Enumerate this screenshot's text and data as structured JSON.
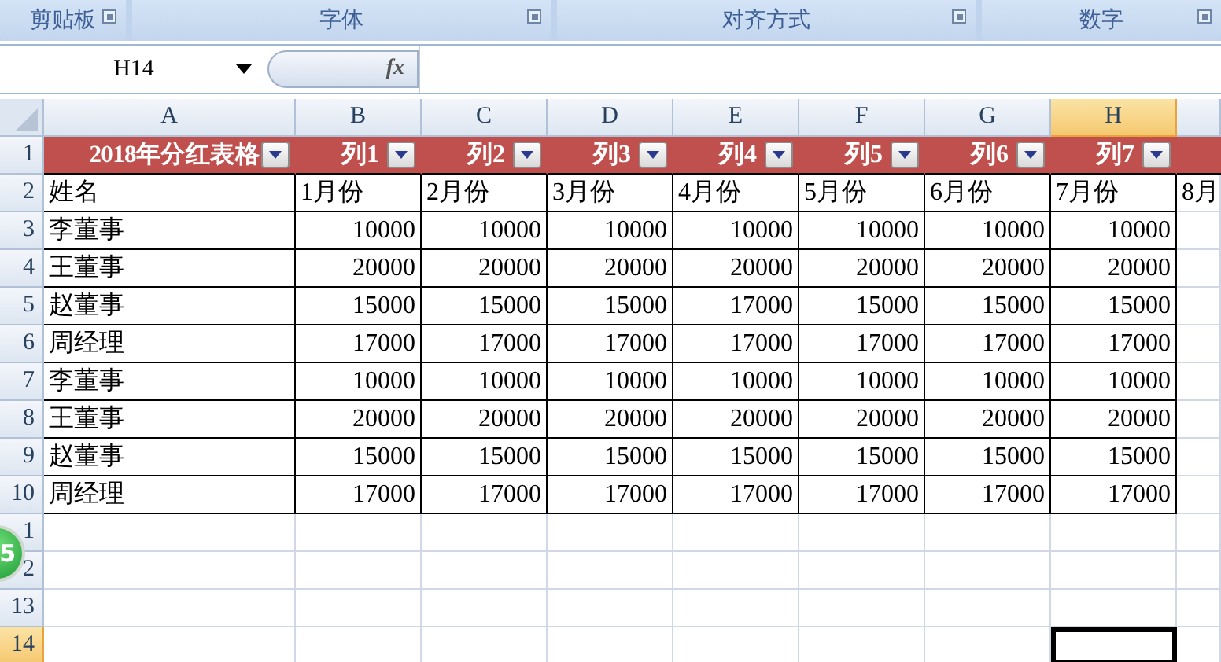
{
  "ribbon_groups": [
    {
      "label": "剪贴板"
    },
    {
      "label": "字体"
    },
    {
      "label": "对齐方式"
    },
    {
      "label": "数字"
    }
  ],
  "name_box": {
    "value": "H14"
  },
  "formula_bar": {
    "fx_label": "fx"
  },
  "columns": [
    {
      "letter": "A",
      "selected": false
    },
    {
      "letter": "B",
      "selected": false
    },
    {
      "letter": "C",
      "selected": false
    },
    {
      "letter": "D",
      "selected": false
    },
    {
      "letter": "E",
      "selected": false
    },
    {
      "letter": "F",
      "selected": false
    },
    {
      "letter": "G",
      "selected": false
    },
    {
      "letter": "H",
      "selected": true
    }
  ],
  "rows": [
    {
      "number": "1",
      "kind": "header",
      "selected": false,
      "cells": [
        "2018年分红表格",
        "列1",
        "列2",
        "列3",
        "列4",
        "列5",
        "列6",
        "列7"
      ]
    },
    {
      "number": "2",
      "kind": "labels",
      "selected": false,
      "cells": [
        "姓名",
        "1月份",
        "2月份",
        "3月份",
        "4月份",
        "5月份",
        "6月份",
        "7月份",
        "8月"
      ]
    },
    {
      "number": "3",
      "kind": "data",
      "selected": false,
      "cells": [
        "李董事",
        "10000",
        "10000",
        "10000",
        "10000",
        "10000",
        "10000",
        "10000"
      ]
    },
    {
      "number": "4",
      "kind": "data",
      "selected": false,
      "cells": [
        "王董事",
        "20000",
        "20000",
        "20000",
        "20000",
        "20000",
        "20000",
        "20000"
      ]
    },
    {
      "number": "5",
      "kind": "data",
      "selected": false,
      "cells": [
        "赵董事",
        "15000",
        "15000",
        "15000",
        "17000",
        "15000",
        "15000",
        "15000"
      ]
    },
    {
      "number": "6",
      "kind": "data",
      "selected": false,
      "cells": [
        "周经理",
        "17000",
        "17000",
        "17000",
        "17000",
        "17000",
        "17000",
        "17000"
      ]
    },
    {
      "number": "7",
      "kind": "data",
      "selected": false,
      "cells": [
        "李董事",
        "10000",
        "10000",
        "10000",
        "10000",
        "10000",
        "10000",
        "10000"
      ]
    },
    {
      "number": "8",
      "kind": "data",
      "selected": false,
      "cells": [
        "王董事",
        "20000",
        "20000",
        "20000",
        "20000",
        "20000",
        "20000",
        "20000"
      ]
    },
    {
      "number": "9",
      "kind": "data",
      "selected": false,
      "cells": [
        "赵董事",
        "15000",
        "15000",
        "15000",
        "15000",
        "15000",
        "15000",
        "15000"
      ]
    },
    {
      "number": "10",
      "kind": "data",
      "selected": false,
      "cells": [
        "周经理",
        "17000",
        "17000",
        "17000",
        "17000",
        "17000",
        "17000",
        "17000"
      ]
    },
    {
      "number": "1",
      "kind": "empty",
      "selected": false,
      "cells": []
    },
    {
      "number": "2",
      "kind": "empty",
      "selected": false,
      "cells": []
    },
    {
      "number": "13",
      "kind": "empty",
      "selected": false,
      "cells": []
    },
    {
      "number": "14",
      "kind": "empty",
      "selected": true,
      "cells": []
    }
  ],
  "floating_ball": {
    "label": "5"
  }
}
